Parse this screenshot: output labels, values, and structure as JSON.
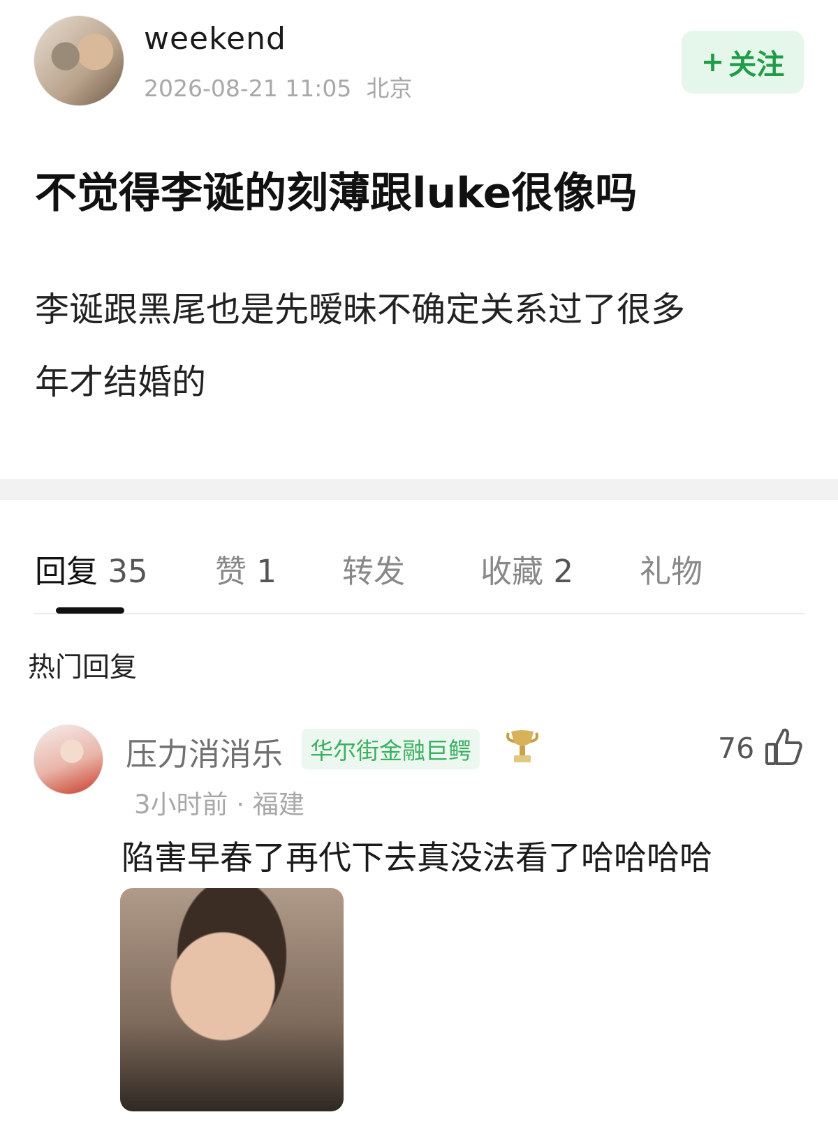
{
  "post": {
    "author": "weekend",
    "meta": "2026-08-21 11:05  北京",
    "follow_label": "关注",
    "follow_plus": "+",
    "title": "不觉得李诞的刻薄跟luke很像吗",
    "body_line1": "李诞跟黑尾也是先暧昧不确定关系过了很多",
    "body_line2": "年才结婚的"
  },
  "tabs": [
    {
      "label": "回复",
      "count": "35",
      "active": true
    },
    {
      "label": "赞",
      "count": "1"
    },
    {
      "label": "转发",
      "count": ""
    },
    {
      "label": "收藏",
      "count": "2"
    },
    {
      "label": "礼物",
      "count": ""
    }
  ],
  "section_title": "热门回复",
  "reply": {
    "name": "压力消消乐",
    "badge": "华尔街金融巨鳄",
    "likes": "76",
    "meta": "3小时前 · 福建",
    "text": "陷害早春了再代下去真没法看了哈哈哈哈"
  },
  "colors": {
    "accent_green": "#1e9c47",
    "follow_bg": "#e5f6ea",
    "badge_green": "#3bb062",
    "muted_text": "#a8a8a8"
  },
  "icons": [
    "avatar",
    "trophy-icon",
    "thumb-up-icon",
    "plus-icon"
  ]
}
